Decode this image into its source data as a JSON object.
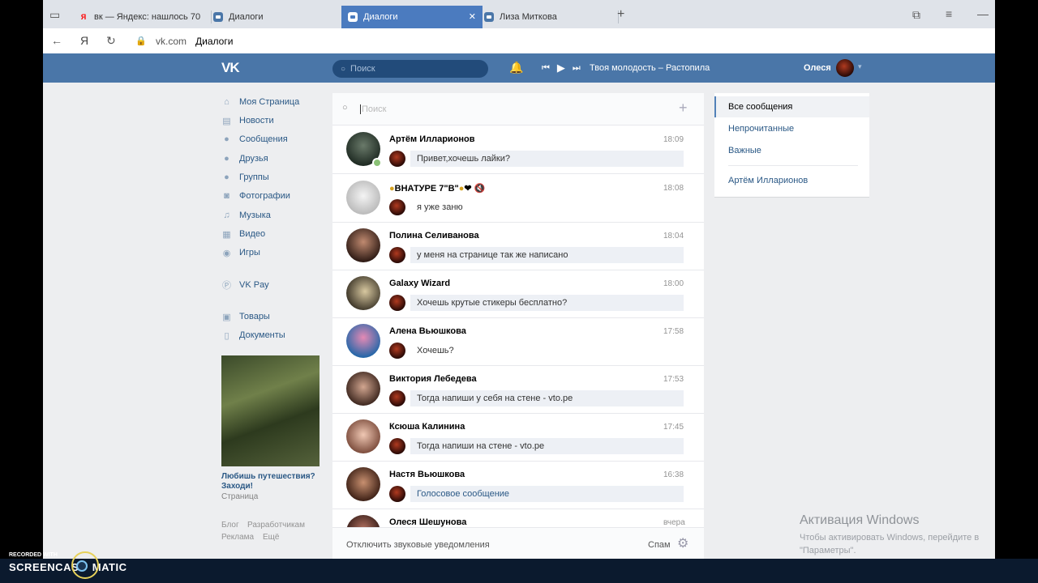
{
  "browser": {
    "tabs": [
      {
        "label": "вк — Яндекс: нашлось 70",
        "favicon": "yandex-icon"
      },
      {
        "label": "Диалоги",
        "favicon": "vk-icon"
      },
      {
        "label": "Диалоги",
        "favicon": "vk-icon",
        "active": true
      },
      {
        "label": "Лиза Миткова",
        "favicon": "vk-icon"
      }
    ],
    "yandex_letter": "Я",
    "address_brand": "Я",
    "url": "vk.com",
    "page_title": "Диалоги"
  },
  "header": {
    "logo": "VK",
    "search_placeholder": "Поиск",
    "track": "Твоя молодость – Растопила",
    "user_name": "Олеся"
  },
  "menu": {
    "items": [
      {
        "label": "Моя Страница",
        "icon": "home-icon"
      },
      {
        "label": "Новости",
        "icon": "news-icon"
      },
      {
        "label": "Сообщения",
        "icon": "messages-icon"
      },
      {
        "label": "Друзья",
        "icon": "friends-icon"
      },
      {
        "label": "Группы",
        "icon": "groups-icon"
      },
      {
        "label": "Фотографии",
        "icon": "camera-icon"
      },
      {
        "label": "Музыка",
        "icon": "music-icon"
      },
      {
        "label": "Видео",
        "icon": "video-icon"
      },
      {
        "label": "Игры",
        "icon": "games-icon"
      },
      {
        "label": "VK Pay",
        "icon": "pay-icon"
      },
      {
        "label": "Товары",
        "icon": "bag-icon"
      },
      {
        "label": "Документы",
        "icon": "document-icon"
      }
    ],
    "promo_title": "Любишь путешествия? Заходи!",
    "promo_sub": "Страница",
    "footer": [
      "Блог",
      "Разработчикам",
      "Реклама",
      "Ещё"
    ]
  },
  "dialogs": {
    "search_placeholder": "Поиск",
    "items": [
      {
        "name": "Артём Илларионов",
        "time": "18:09",
        "message": "Привет,хочешь лайки?",
        "unread": true
      },
      {
        "name": "ВНАТУРЕ 7\"В\"",
        "time": "18:08",
        "message": "я уже заню",
        "unread": false
      },
      {
        "name": "Полина Селиванова",
        "time": "18:04",
        "message": "у меня на странице так же написано",
        "unread": true
      },
      {
        "name": "Galaxy Wizard",
        "time": "18:00",
        "message": "Хочешь крутые стикеры бесплатно?",
        "unread": true
      },
      {
        "name": "Алена Вьюшкова",
        "time": "17:58",
        "message": "Хочешь?",
        "unread": false
      },
      {
        "name": "Виктория Лебедева",
        "time": "17:53",
        "message": "Тогда напиши у себя на стене - vto.pe",
        "unread": true
      },
      {
        "name": "Ксюша Калинина",
        "time": "17:45",
        "message": "Тогда напиши на стене - vto.pe",
        "unread": true
      },
      {
        "name": "Настя Вьюшкова",
        "time": "16:38",
        "message": "Голосовое сообщение",
        "unread": true
      },
      {
        "name": "Олеся Шешунова",
        "time": "вчера",
        "message": "",
        "unread": false
      }
    ],
    "footer_mute": "Отключить звуковые уведомления",
    "footer_spam": "Спам"
  },
  "filters": {
    "items": [
      "Все сообщения",
      "Непрочитанные",
      "Важные"
    ],
    "pinned": "Артём Илларионов"
  },
  "overlay": {
    "windows_title": "Активация Windows",
    "windows_text": "Чтобы активировать Windows, перейдите в \"Параметры\".",
    "recorded": "RECORDED WITH",
    "brand": "SCREENCAST  MATIC"
  },
  "colors": {
    "vk_blue": "#4a76a8",
    "link": "#2a5885",
    "active_tab": "#4b7bbf"
  }
}
